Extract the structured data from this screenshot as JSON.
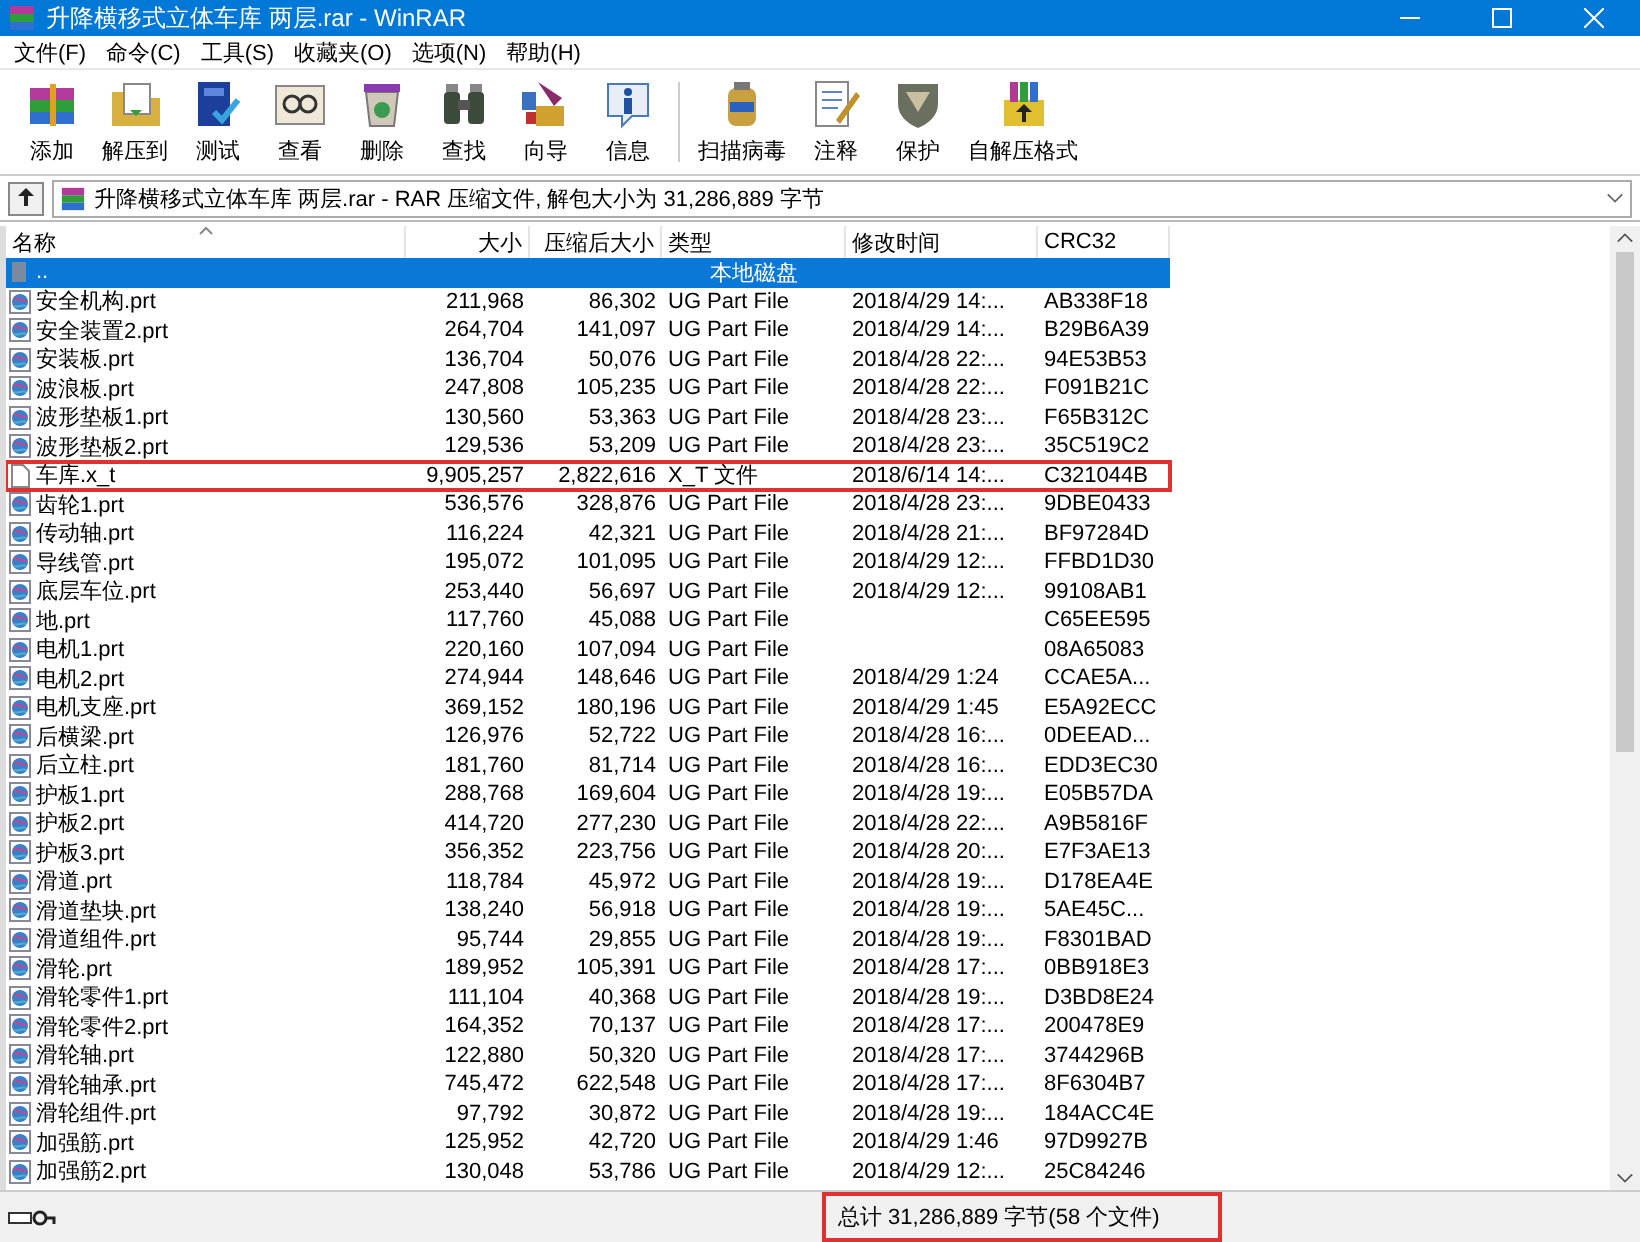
{
  "window": {
    "title": "升降横移式立体车库 两层.rar - WinRAR"
  },
  "menu": [
    "文件(F)",
    "命令(C)",
    "工具(S)",
    "收藏夹(O)",
    "选项(N)",
    "帮助(H)"
  ],
  "toolbar": {
    "groups": [
      [
        "添加",
        "解压到",
        "测试",
        "查看",
        "删除",
        "查找",
        "向导",
        "信息"
      ],
      [
        "扫描病毒",
        "注释",
        "保护",
        "自解压格式"
      ]
    ]
  },
  "address": {
    "text": "升降横移式立体车库 两层.rar - RAR 压缩文件, 解包大小为 31,286,889 字节"
  },
  "columns": [
    "名称",
    "大小",
    "压缩后大小",
    "类型",
    "修改时间",
    "CRC32"
  ],
  "rows": [
    {
      "kind": "parent",
      "name": "..",
      "type": "本地磁盘",
      "selected": true,
      "highlighted": false
    },
    {
      "kind": "part",
      "name": "安全机构.prt",
      "size": "211,968",
      "packed": "86,302",
      "type": "UG Part File",
      "modified": "2018/4/29 14:...",
      "crc": "AB338F18",
      "selected": false,
      "highlighted": false
    },
    {
      "kind": "part",
      "name": "安全装置2.prt",
      "size": "264,704",
      "packed": "141,097",
      "type": "UG Part File",
      "modified": "2018/4/29 14:...",
      "crc": "B29B6A39",
      "selected": false,
      "highlighted": false
    },
    {
      "kind": "part",
      "name": "安装板.prt",
      "size": "136,704",
      "packed": "50,076",
      "type": "UG Part File",
      "modified": "2018/4/28 22:...",
      "crc": "94E53B53",
      "selected": false,
      "highlighted": false
    },
    {
      "kind": "part",
      "name": "波浪板.prt",
      "size": "247,808",
      "packed": "105,235",
      "type": "UG Part File",
      "modified": "2018/4/28 22:...",
      "crc": "F091B21C",
      "selected": false,
      "highlighted": false
    },
    {
      "kind": "part",
      "name": "波形垫板1.prt",
      "size": "130,560",
      "packed": "53,363",
      "type": "UG Part File",
      "modified": "2018/4/28 23:...",
      "crc": "F65B312C",
      "selected": false,
      "highlighted": false
    },
    {
      "kind": "part",
      "name": "波形垫板2.prt",
      "size": "129,536",
      "packed": "53,209",
      "type": "UG Part File",
      "modified": "2018/4/28 23:...",
      "crc": "35C519C2",
      "selected": false,
      "highlighted": false
    },
    {
      "kind": "document",
      "name": "车库.x_t",
      "size": "9,905,257",
      "packed": "2,822,616",
      "type": "X_T 文件",
      "modified": "2018/6/14 14:...",
      "crc": "C321044B",
      "selected": false,
      "highlighted": true
    },
    {
      "kind": "part",
      "name": "齿轮1.prt",
      "size": "536,576",
      "packed": "328,876",
      "type": "UG Part File",
      "modified": "2018/4/28 23:...",
      "crc": "9DBE0433",
      "selected": false,
      "highlighted": false
    },
    {
      "kind": "part",
      "name": "传动轴.prt",
      "size": "116,224",
      "packed": "42,321",
      "type": "UG Part File",
      "modified": "2018/4/28 21:...",
      "crc": "BF97284D",
      "selected": false,
      "highlighted": false
    },
    {
      "kind": "part",
      "name": "导线管.prt",
      "size": "195,072",
      "packed": "101,095",
      "type": "UG Part File",
      "modified": "2018/4/29 12:...",
      "crc": "FFBD1D30",
      "selected": false,
      "highlighted": false
    },
    {
      "kind": "part",
      "name": "底层车位.prt",
      "size": "253,440",
      "packed": "56,697",
      "type": "UG Part File",
      "modified": "2018/4/29 12:...",
      "crc": "99108AB1",
      "selected": false,
      "highlighted": false
    },
    {
      "kind": "part",
      "name": "地.prt",
      "size": "117,760",
      "packed": "45,088",
      "type": "UG Part File",
      "crc": "C65EE595",
      "selected": false,
      "highlighted": false
    },
    {
      "kind": "part",
      "name": "电机1.prt",
      "size": "220,160",
      "packed": "107,094",
      "type": "UG Part File",
      "crc": "08A65083",
      "selected": false,
      "highlighted": false
    },
    {
      "kind": "part",
      "name": "电机2.prt",
      "size": "274,944",
      "packed": "148,646",
      "type": "UG Part File",
      "modified": "2018/4/29 1:24",
      "crc": "CCAE5A...",
      "selected": false,
      "highlighted": false
    },
    {
      "kind": "part",
      "name": "电机支座.prt",
      "size": "369,152",
      "packed": "180,196",
      "type": "UG Part File",
      "modified": "2018/4/29 1:45",
      "crc": "E5A92ECC",
      "selected": false,
      "highlighted": false
    },
    {
      "kind": "part",
      "name": "后横梁.prt",
      "size": "126,976",
      "packed": "52,722",
      "type": "UG Part File",
      "modified": "2018/4/28 16:...",
      "crc": "0DEEAD...",
      "selected": false,
      "highlighted": false
    },
    {
      "kind": "part",
      "name": "后立柱.prt",
      "size": "181,760",
      "packed": "81,714",
      "type": "UG Part File",
      "modified": "2018/4/28 16:...",
      "crc": "EDD3EC30",
      "selected": false,
      "highlighted": false
    },
    {
      "kind": "part",
      "name": "护板1.prt",
      "size": "288,768",
      "packed": "169,604",
      "type": "UG Part File",
      "modified": "2018/4/28 19:...",
      "crc": "E05B57DA",
      "selected": false,
      "highlighted": false
    },
    {
      "kind": "part",
      "name": "护板2.prt",
      "size": "414,720",
      "packed": "277,230",
      "type": "UG Part File",
      "modified": "2018/4/28 22:...",
      "crc": "A9B5816F",
      "selected": false,
      "highlighted": false
    },
    {
      "kind": "part",
      "name": "护板3.prt",
      "size": "356,352",
      "packed": "223,756",
      "type": "UG Part File",
      "modified": "2018/4/28 20:...",
      "crc": "E7F3AE13",
      "selected": false,
      "highlighted": false
    },
    {
      "kind": "part",
      "name": "滑道.prt",
      "size": "118,784",
      "packed": "45,972",
      "type": "UG Part File",
      "modified": "2018/4/28 19:...",
      "crc": "D178EA4E",
      "selected": false,
      "highlighted": false
    },
    {
      "kind": "part",
      "name": "滑道垫块.prt",
      "size": "138,240",
      "packed": "56,918",
      "type": "UG Part File",
      "modified": "2018/4/28 19:...",
      "crc": "5AE45C...",
      "selected": false,
      "highlighted": false
    },
    {
      "kind": "part",
      "name": "滑道组件.prt",
      "size": "95,744",
      "packed": "29,855",
      "type": "UG Part File",
      "modified": "2018/4/28 19:...",
      "crc": "F8301BAD",
      "selected": false,
      "highlighted": false
    },
    {
      "kind": "part",
      "name": "滑轮.prt",
      "size": "189,952",
      "packed": "105,391",
      "type": "UG Part File",
      "modified": "2018/4/28 17:...",
      "crc": "0BB918E3",
      "selected": false,
      "highlighted": false
    },
    {
      "kind": "part",
      "name": "滑轮零件1.prt",
      "size": "111,104",
      "packed": "40,368",
      "type": "UG Part File",
      "modified": "2018/4/28 19:...",
      "crc": "D3BD8E24",
      "selected": false,
      "highlighted": false
    },
    {
      "kind": "part",
      "name": "滑轮零件2.prt",
      "size": "164,352",
      "packed": "70,137",
      "type": "UG Part File",
      "modified": "2018/4/28 17:...",
      "crc": "200478E9",
      "selected": false,
      "highlighted": false
    },
    {
      "kind": "part",
      "name": "滑轮轴.prt",
      "size": "122,880",
      "packed": "50,320",
      "type": "UG Part File",
      "modified": "2018/4/28 17:...",
      "crc": "3744296B",
      "selected": false,
      "highlighted": false
    },
    {
      "kind": "part",
      "name": "滑轮轴承.prt",
      "size": "745,472",
      "packed": "622,548",
      "type": "UG Part File",
      "modified": "2018/4/28 17:...",
      "crc": "8F6304B7",
      "selected": false,
      "highlighted": false
    },
    {
      "kind": "part",
      "name": "滑轮组件.prt",
      "size": "97,792",
      "packed": "30,872",
      "type": "UG Part File",
      "modified": "2018/4/28 19:...",
      "crc": "184ACC4E",
      "selected": false,
      "highlighted": false
    },
    {
      "kind": "part",
      "name": "加强筋.prt",
      "size": "125,952",
      "packed": "42,720",
      "type": "UG Part File",
      "modified": "2018/4/29 1:46",
      "crc": "97D9927B",
      "selected": false,
      "highlighted": false
    },
    {
      "kind": "part",
      "name": "加强筋2.prt",
      "size": "130,048",
      "packed": "53,786",
      "type": "UG Part File",
      "modified": "2018/4/29 12:...",
      "crc": "25C84246",
      "selected": false,
      "highlighted": false
    }
  ],
  "status": {
    "total": "总计 31,286,889 字节(58 个文件)",
    "highlighted": true
  }
}
